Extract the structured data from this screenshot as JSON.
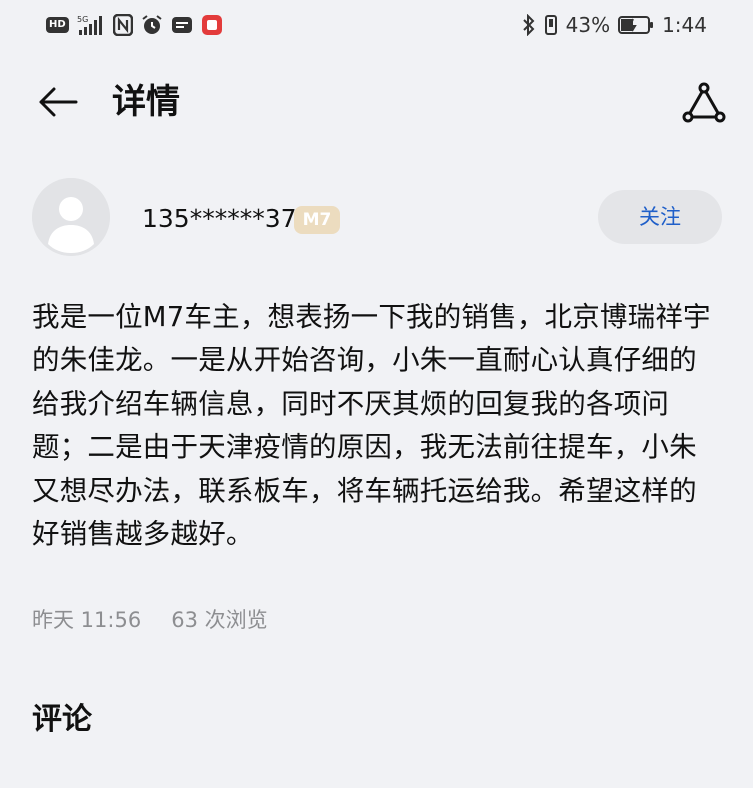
{
  "status_bar": {
    "hd_label": "HD",
    "network_label": "5G",
    "battery_percent": "43%",
    "time": "1:44"
  },
  "header": {
    "title": "详情"
  },
  "author": {
    "username": "135******37",
    "level_badge": "M7",
    "follow_label": "关注"
  },
  "post": {
    "content": "我是一位M7车主，想表扬一下我的销售，北京博瑞祥宇的朱佳龙。一是从开始咨询，小朱一直耐心认真仔细的给我介绍车辆信息，同时不厌其烦的回复我的各项问题；二是由于天津疫情的原因，我无法前往提车，小朱又想尽办法，联系板车，将车辆托运给我。希望这样的好销售越多越好。",
    "time": "昨天 11:56",
    "views": "63 次浏览"
  },
  "comments": {
    "heading": "评论"
  },
  "icons": {
    "back": "back-arrow-icon",
    "share": "share-icon",
    "avatar": "default-avatar-icon"
  },
  "colors": {
    "background": "#f1f2f5",
    "accent": "#1f5fc9",
    "badge": "#ecdcbf",
    "meta_text": "#8d8e91"
  }
}
